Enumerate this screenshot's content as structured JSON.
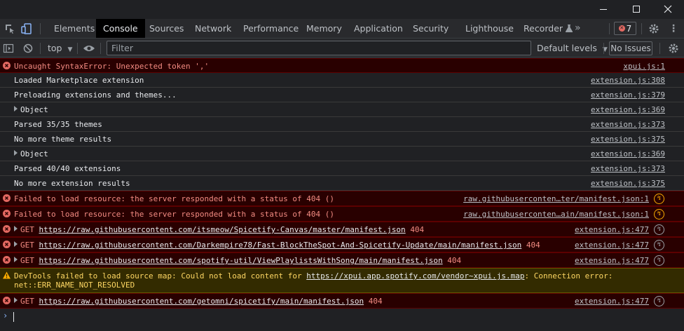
{
  "tabs": [
    "Elements",
    "Console",
    "Sources",
    "Network",
    "Performance",
    "Memory",
    "Application",
    "Security",
    "Lighthouse",
    "Recorder"
  ],
  "error_count": "7",
  "toolbar": {
    "context": "top",
    "filter_placeholder": "Filter",
    "levels": "Default levels",
    "issues": "No Issues"
  },
  "colors": {
    "error_bg": "#290000",
    "warning_bg": "#332b00",
    "accent": "#8ab4f8"
  },
  "messages": [
    {
      "level": "error",
      "text": "Uncaught SyntaxError: Unexpected token ','",
      "source": "xpui.js:1"
    },
    {
      "level": "log",
      "text": "Loaded Marketplace extension",
      "source": "extension.js:308"
    },
    {
      "level": "log",
      "text": "Preloading extensions and themes...",
      "source": "extension.js:379"
    },
    {
      "level": "log",
      "text": "Object",
      "expandable": true,
      "source": "extension.js:369"
    },
    {
      "level": "log",
      "text": "Parsed 35/35 themes",
      "source": "extension.js:373"
    },
    {
      "level": "log",
      "text": "No more theme results",
      "source": "extension.js:375"
    },
    {
      "level": "log",
      "text": "Object",
      "expandable": true,
      "source": "extension.js:369"
    },
    {
      "level": "log",
      "text": "Parsed 40/40 extensions",
      "source": "extension.js:373"
    },
    {
      "level": "log",
      "text": "No more extension results",
      "source": "extension.js:375"
    },
    {
      "level": "error",
      "text": "Failed to load resource: the server responded with a status of 404 ()",
      "source": "raw.githubuserconten…ter/manifest.json:1",
      "icon": "warning-circle-icon"
    },
    {
      "level": "error",
      "text": "Failed to load resource: the server responded with a status of 404 ()",
      "source": "raw.githubuserconten…ain/manifest.json:1",
      "icon": "warning-circle-icon"
    },
    {
      "level": "error",
      "method": "GET",
      "url": "https://raw.githubusercontent.com/itsmeow/Spicetify-Canvas/master/manifest.json",
      "status": "404",
      "source": "extension.js:477",
      "icon": "network-icon"
    },
    {
      "level": "error",
      "method": "GET",
      "url": "https://raw.githubusercontent.com/Darkempire78/Fast-BlockTheSpot-And-Spicetify-Update/main/manifest.json",
      "status": "404",
      "source": "extension.js:477",
      "icon": "network-icon"
    },
    {
      "level": "error",
      "method": "GET",
      "url": "https://raw.githubusercontent.com/spotify-util/ViewPlaylistsWithSong/main/manifest.json",
      "status": "404",
      "source": "extension.js:477",
      "icon": "network-icon"
    },
    {
      "level": "warning",
      "prefix": "DevTools failed to load source map: Could not load content for ",
      "url": "https://xpui.app.spotify.com/vendor~xpui.js.map",
      "suffix": ": Connection error: net::ERR_NAME_NOT_RESOLVED"
    },
    {
      "level": "error",
      "method": "GET",
      "url": "https://raw.githubusercontent.com/getomni/spicetify/main/manifest.json",
      "status": "404",
      "source": "extension.js:477",
      "icon": "network-icon"
    }
  ],
  "prompt_symbol": "›"
}
